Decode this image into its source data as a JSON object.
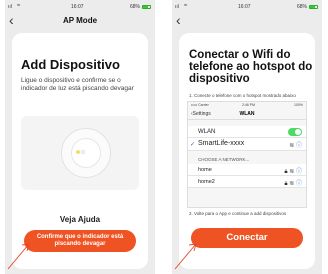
{
  "left": {
    "status": {
      "signal": "ııl",
      "time": "16:07",
      "battery": "68%"
    },
    "nav": {
      "back": "‹",
      "title": "AP Mode"
    },
    "heading": "Add Dispositivo",
    "description": "Ligue o dispositivo e confirme se o indicador de luz está piscando devagar",
    "help_link": "Veja Ajuda",
    "confirm_button": "Confirme que o indicador está piscando devagar"
  },
  "right": {
    "status": {
      "signal": "ııl",
      "time": "16:07",
      "battery": "68%"
    },
    "nav": {
      "back": "‹"
    },
    "heading": "Conectar o Wifi do telefone ao hotspot do dispositivo",
    "step1": "1. Conecte o telefone com o hotspot mostrado abaixo",
    "wifi_settings": {
      "carrier": "••••• Carrier",
      "time": "2:46 PM",
      "battery": "100%",
      "back": "Settings",
      "title": "WLAN",
      "wlan_label": "WLAN",
      "selected_network": "SmartLife-xxxx",
      "choose_label": "CHOOSE A NETWORK...",
      "networks": [
        "home",
        "home2"
      ]
    },
    "step2": "2. Volte para o App e continue a add dispositivos",
    "connect_button": "Conectar"
  },
  "colors": {
    "accent": "#f05323",
    "toggle_on": "#4cd964",
    "link_blue": "#2a6cd3"
  }
}
